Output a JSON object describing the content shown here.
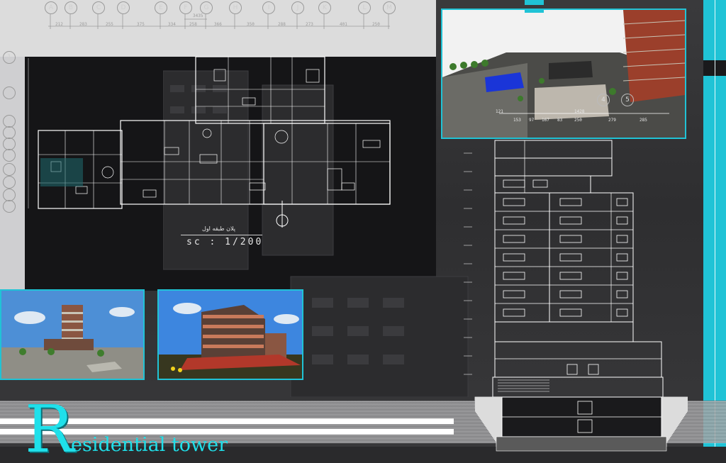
{
  "title": {
    "initial": "R",
    "rest": "esidential tower"
  },
  "plan": {
    "caption_fa": "پلان طبقه اول",
    "scale_label": "sc",
    "scale_sep": ":",
    "scale_value": "1/200"
  },
  "grid_top": {
    "letters": [
      "A",
      "B",
      "C",
      "D",
      "E",
      "F",
      "G",
      "H",
      "I",
      "J",
      "K",
      "L",
      "M"
    ],
    "total": "3435",
    "dims": [
      "212",
      "283",
      "255",
      "375",
      "334",
      "258",
      "366",
      "350",
      "288",
      "273",
      "401",
      "250"
    ]
  },
  "grid_left": {
    "numbers": [
      "1",
      "2",
      "3",
      "4",
      "5",
      "6",
      "7",
      "8",
      "9",
      "10"
    ]
  },
  "render_dims": {
    "axis": [
      "4",
      "5"
    ],
    "total": "1428",
    "dims": [
      "121",
      "153",
      "97",
      "167",
      "83",
      "250",
      "279",
      "285"
    ]
  },
  "colors": {
    "accent": "#1fe0ea",
    "frame": "#20c3d6",
    "line": "#ffffff",
    "background": "#2e2e30"
  }
}
